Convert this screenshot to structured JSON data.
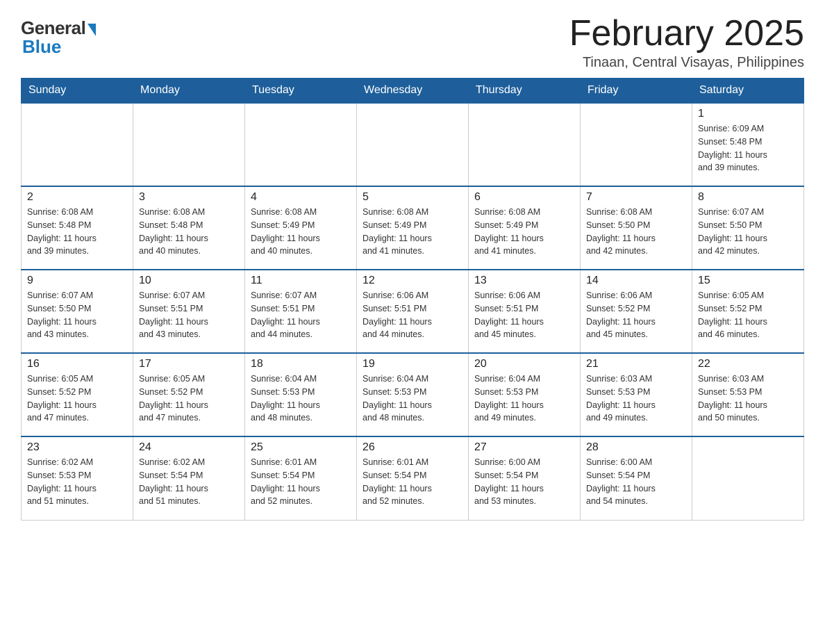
{
  "header": {
    "logo_general": "General",
    "logo_blue": "Blue",
    "month_title": "February 2025",
    "location": "Tinaan, Central Visayas, Philippines"
  },
  "days_of_week": [
    "Sunday",
    "Monday",
    "Tuesday",
    "Wednesday",
    "Thursday",
    "Friday",
    "Saturday"
  ],
  "weeks": [
    [
      {
        "day": "",
        "info": ""
      },
      {
        "day": "",
        "info": ""
      },
      {
        "day": "",
        "info": ""
      },
      {
        "day": "",
        "info": ""
      },
      {
        "day": "",
        "info": ""
      },
      {
        "day": "",
        "info": ""
      },
      {
        "day": "1",
        "info": "Sunrise: 6:09 AM\nSunset: 5:48 PM\nDaylight: 11 hours\nand 39 minutes."
      }
    ],
    [
      {
        "day": "2",
        "info": "Sunrise: 6:08 AM\nSunset: 5:48 PM\nDaylight: 11 hours\nand 39 minutes."
      },
      {
        "day": "3",
        "info": "Sunrise: 6:08 AM\nSunset: 5:48 PM\nDaylight: 11 hours\nand 40 minutes."
      },
      {
        "day": "4",
        "info": "Sunrise: 6:08 AM\nSunset: 5:49 PM\nDaylight: 11 hours\nand 40 minutes."
      },
      {
        "day": "5",
        "info": "Sunrise: 6:08 AM\nSunset: 5:49 PM\nDaylight: 11 hours\nand 41 minutes."
      },
      {
        "day": "6",
        "info": "Sunrise: 6:08 AM\nSunset: 5:49 PM\nDaylight: 11 hours\nand 41 minutes."
      },
      {
        "day": "7",
        "info": "Sunrise: 6:08 AM\nSunset: 5:50 PM\nDaylight: 11 hours\nand 42 minutes."
      },
      {
        "day": "8",
        "info": "Sunrise: 6:07 AM\nSunset: 5:50 PM\nDaylight: 11 hours\nand 42 minutes."
      }
    ],
    [
      {
        "day": "9",
        "info": "Sunrise: 6:07 AM\nSunset: 5:50 PM\nDaylight: 11 hours\nand 43 minutes."
      },
      {
        "day": "10",
        "info": "Sunrise: 6:07 AM\nSunset: 5:51 PM\nDaylight: 11 hours\nand 43 minutes."
      },
      {
        "day": "11",
        "info": "Sunrise: 6:07 AM\nSunset: 5:51 PM\nDaylight: 11 hours\nand 44 minutes."
      },
      {
        "day": "12",
        "info": "Sunrise: 6:06 AM\nSunset: 5:51 PM\nDaylight: 11 hours\nand 44 minutes."
      },
      {
        "day": "13",
        "info": "Sunrise: 6:06 AM\nSunset: 5:51 PM\nDaylight: 11 hours\nand 45 minutes."
      },
      {
        "day": "14",
        "info": "Sunrise: 6:06 AM\nSunset: 5:52 PM\nDaylight: 11 hours\nand 45 minutes."
      },
      {
        "day": "15",
        "info": "Sunrise: 6:05 AM\nSunset: 5:52 PM\nDaylight: 11 hours\nand 46 minutes."
      }
    ],
    [
      {
        "day": "16",
        "info": "Sunrise: 6:05 AM\nSunset: 5:52 PM\nDaylight: 11 hours\nand 47 minutes."
      },
      {
        "day": "17",
        "info": "Sunrise: 6:05 AM\nSunset: 5:52 PM\nDaylight: 11 hours\nand 47 minutes."
      },
      {
        "day": "18",
        "info": "Sunrise: 6:04 AM\nSunset: 5:53 PM\nDaylight: 11 hours\nand 48 minutes."
      },
      {
        "day": "19",
        "info": "Sunrise: 6:04 AM\nSunset: 5:53 PM\nDaylight: 11 hours\nand 48 minutes."
      },
      {
        "day": "20",
        "info": "Sunrise: 6:04 AM\nSunset: 5:53 PM\nDaylight: 11 hours\nand 49 minutes."
      },
      {
        "day": "21",
        "info": "Sunrise: 6:03 AM\nSunset: 5:53 PM\nDaylight: 11 hours\nand 49 minutes."
      },
      {
        "day": "22",
        "info": "Sunrise: 6:03 AM\nSunset: 5:53 PM\nDaylight: 11 hours\nand 50 minutes."
      }
    ],
    [
      {
        "day": "23",
        "info": "Sunrise: 6:02 AM\nSunset: 5:53 PM\nDaylight: 11 hours\nand 51 minutes."
      },
      {
        "day": "24",
        "info": "Sunrise: 6:02 AM\nSunset: 5:54 PM\nDaylight: 11 hours\nand 51 minutes."
      },
      {
        "day": "25",
        "info": "Sunrise: 6:01 AM\nSunset: 5:54 PM\nDaylight: 11 hours\nand 52 minutes."
      },
      {
        "day": "26",
        "info": "Sunrise: 6:01 AM\nSunset: 5:54 PM\nDaylight: 11 hours\nand 52 minutes."
      },
      {
        "day": "27",
        "info": "Sunrise: 6:00 AM\nSunset: 5:54 PM\nDaylight: 11 hours\nand 53 minutes."
      },
      {
        "day": "28",
        "info": "Sunrise: 6:00 AM\nSunset: 5:54 PM\nDaylight: 11 hours\nand 54 minutes."
      },
      {
        "day": "",
        "info": ""
      }
    ]
  ]
}
